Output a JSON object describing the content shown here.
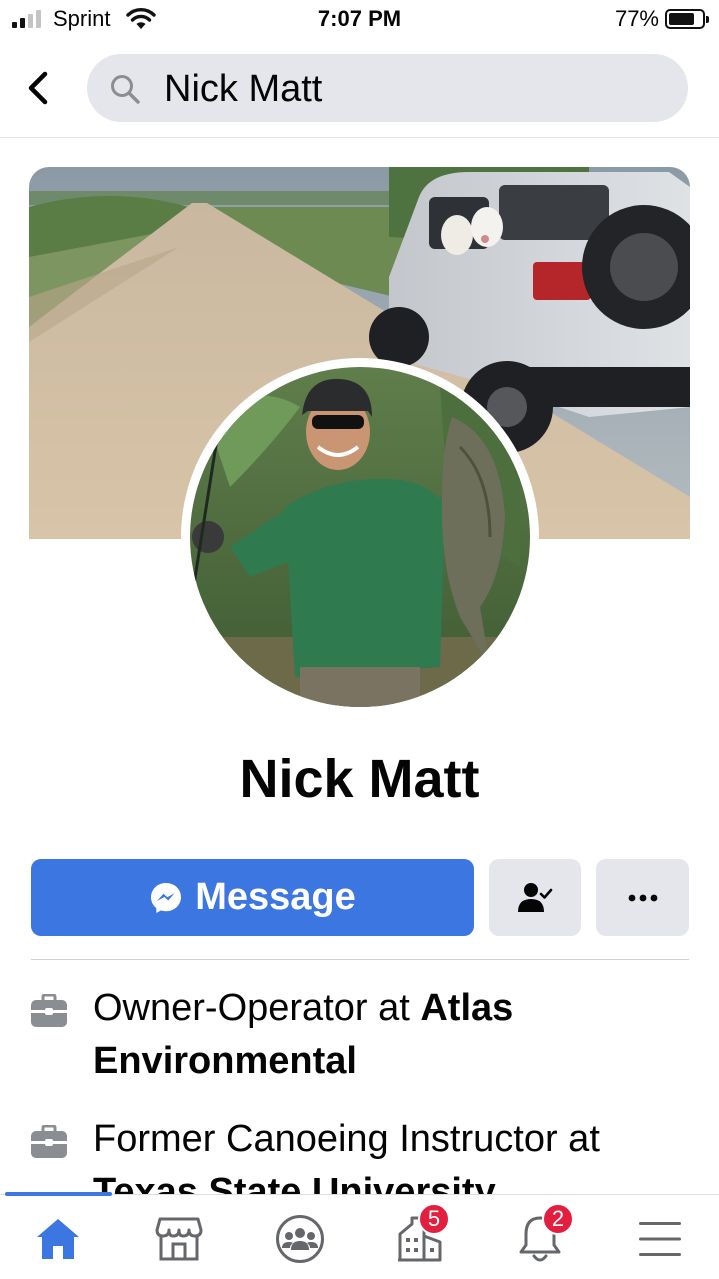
{
  "status_bar": {
    "carrier": "Sprint",
    "time": "7:07 PM",
    "battery_percent": "77%",
    "battery_level": 0.77,
    "signal_bars": 2
  },
  "header": {
    "back_icon": "chevron-left-icon",
    "search_icon": "search-icon",
    "search_query": "Nick Matt"
  },
  "profile": {
    "name": "Nick Matt",
    "cover_photo": "cover-photo",
    "profile_photo": "profile-photo"
  },
  "actions": {
    "message_label": "Message",
    "message_icon": "messenger-icon",
    "friends_icon": "friend-check-icon",
    "more_icon": "more-dots-icon"
  },
  "intro": [
    {
      "icon": "briefcase-icon",
      "prefix": "Owner-Operator at ",
      "org": "Atlas Environmental"
    },
    {
      "icon": "briefcase-icon",
      "prefix": "Former Canoeing Instructor at ",
      "org": "Texas State University"
    }
  ],
  "bottom_nav": [
    {
      "name": "home",
      "icon": "home-icon",
      "active": true,
      "badge": ""
    },
    {
      "name": "marketplace",
      "icon": "marketplace-icon",
      "active": false,
      "badge": ""
    },
    {
      "name": "groups",
      "icon": "groups-icon",
      "active": false,
      "badge": ""
    },
    {
      "name": "pages",
      "icon": "pages-icon",
      "active": false,
      "badge": "5"
    },
    {
      "name": "notifications",
      "icon": "bell-icon",
      "active": false,
      "badge": "2"
    },
    {
      "name": "menu",
      "icon": "menu-icon",
      "active": false,
      "badge": ""
    }
  ],
  "colors": {
    "accent": "#3b76e1",
    "badge": "#e41e3f",
    "surface": "#e4e6eb",
    "icon_gray": "#65676b"
  }
}
